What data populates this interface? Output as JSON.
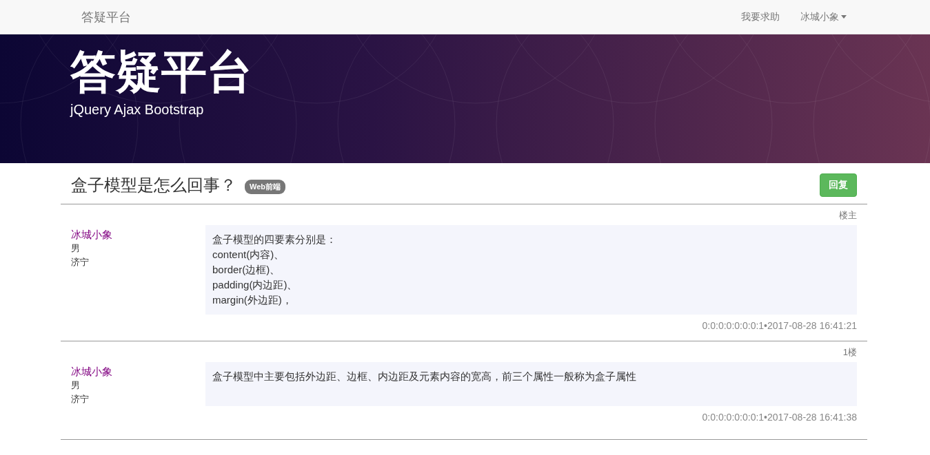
{
  "navbar": {
    "brand": "答疑平台",
    "links": [
      {
        "label": "我要求助",
        "kind": "link"
      },
      {
        "label": "冰城小象",
        "kind": "dropdown"
      }
    ]
  },
  "hero": {
    "title": "答疑平台",
    "subtitle": "jQuery Ajax Bootstrap"
  },
  "question": {
    "title": "盒子模型是怎么回事？",
    "tag": "Web前端",
    "reply_button": "回复"
  },
  "posts": [
    {
      "floor": "楼主",
      "author": "冰城小象",
      "gender": "男",
      "city": "济宁",
      "lines": [
        "盒子模型的四要素分别是：",
        "content(内容)、",
        "border(边框)、",
        "padding(内边距)、",
        "margin(外边距)，"
      ],
      "meta": "0:0:0:0:0:0:0:1•2017-08-28 16:41:21"
    },
    {
      "floor": "1楼",
      "author": "冰城小象",
      "gender": "男",
      "city": "济宁",
      "lines": [
        "盒子模型中主要包括外边距、边框、内边距及元素内容的宽高，前三个属性一般称为盒子属性"
      ],
      "meta": "0:0:0:0:0:0:0:1•2017-08-28 16:41:38"
    }
  ]
}
